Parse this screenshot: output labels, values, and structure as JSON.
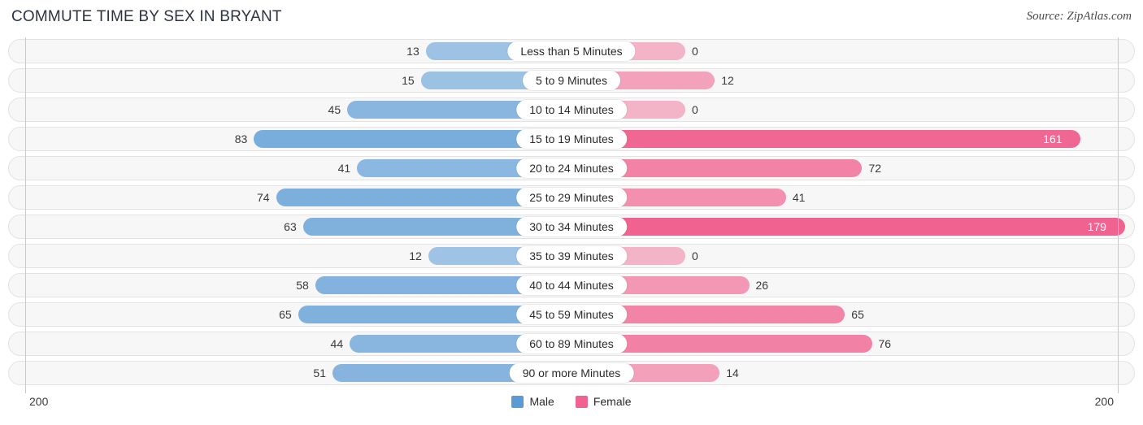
{
  "header": {
    "title": "COMMUTE TIME BY SEX IN BRYANT",
    "source": "Source: ZipAtlas.com"
  },
  "legend": {
    "male_label": "Male",
    "female_label": "Female",
    "male_color": "#5b9bd5",
    "female_color": "#f0628f"
  },
  "axis": {
    "left_max": "200",
    "right_max": "200"
  },
  "chart_data": {
    "type": "bar",
    "title": "COMMUTE TIME BY SEX IN BRYANT",
    "orientation": "horizontal-diverging",
    "xlabel": "",
    "ylabel": "",
    "xlim": [
      200,
      200
    ],
    "grid": false,
    "legend_position": "bottom-center",
    "categories": [
      "Less than 5 Minutes",
      "5 to 9 Minutes",
      "10 to 14 Minutes",
      "15 to 19 Minutes",
      "20 to 24 Minutes",
      "25 to 29 Minutes",
      "30 to 34 Minutes",
      "35 to 39 Minutes",
      "40 to 44 Minutes",
      "45 to 59 Minutes",
      "60 to 89 Minutes",
      "90 or more Minutes"
    ],
    "series": [
      {
        "name": "Male",
        "color": "#5b9bd5",
        "values": [
          13,
          15,
          45,
          83,
          41,
          74,
          63,
          12,
          58,
          65,
          44,
          51
        ]
      },
      {
        "name": "Female",
        "color": "#f0628f",
        "values": [
          0,
          12,
          0,
          161,
          72,
          41,
          179,
          0,
          26,
          65,
          76,
          14
        ]
      }
    ],
    "rows": [
      {
        "category": "Less than 5 Minutes",
        "male": 13,
        "female": 0,
        "male_label": "13",
        "female_label": "0",
        "female_inside": false
      },
      {
        "category": "5 to 9 Minutes",
        "male": 15,
        "female": 12,
        "male_label": "15",
        "female_label": "12",
        "female_inside": false
      },
      {
        "category": "10 to 14 Minutes",
        "male": 45,
        "female": 0,
        "male_label": "45",
        "female_label": "0",
        "female_inside": false
      },
      {
        "category": "15 to 19 Minutes",
        "male": 83,
        "female": 161,
        "male_label": "83",
        "female_label": "161",
        "female_inside": true
      },
      {
        "category": "20 to 24 Minutes",
        "male": 41,
        "female": 72,
        "male_label": "41",
        "female_label": "72",
        "female_inside": false
      },
      {
        "category": "25 to 29 Minutes",
        "male": 74,
        "female": 41,
        "male_label": "74",
        "female_label": "41",
        "female_inside": false
      },
      {
        "category": "30 to 34 Minutes",
        "male": 63,
        "female": 179,
        "male_label": "63",
        "female_label": "179",
        "female_inside": true
      },
      {
        "category": "35 to 39 Minutes",
        "male": 12,
        "female": 0,
        "male_label": "12",
        "female_label": "0",
        "female_inside": false
      },
      {
        "category": "40 to 44 Minutes",
        "male": 58,
        "female": 26,
        "male_label": "58",
        "female_label": "26",
        "female_inside": false
      },
      {
        "category": "45 to 59 Minutes",
        "male": 65,
        "female": 65,
        "male_label": "65",
        "female_label": "65",
        "female_inside": false
      },
      {
        "category": "60 to 89 Minutes",
        "male": 44,
        "female": 76,
        "male_label": "44",
        "female_label": "76",
        "female_inside": false
      },
      {
        "category": "90 or more Minutes",
        "male": 51,
        "female": 14,
        "male_label": "51",
        "female_label": "14",
        "female_inside": false
      }
    ]
  }
}
